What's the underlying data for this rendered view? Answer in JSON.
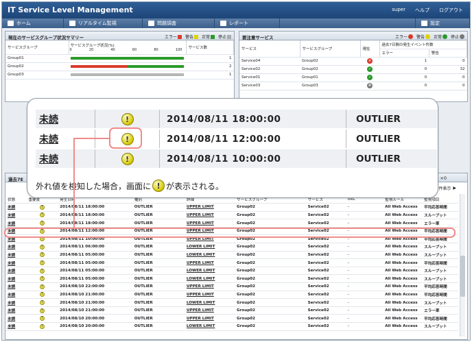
{
  "app": {
    "title": "IT Service Level Management",
    "user": "super",
    "help": "ヘルプ",
    "logout": "ログアウト"
  },
  "nav": {
    "home": "ホーム",
    "realtime": "リアルタイム監視",
    "problem": "問題調査",
    "report": "レポート",
    "settings": "設定"
  },
  "summary": {
    "title": "現在のサービスグループ状況サマリー",
    "legend": {
      "error": "エラー",
      "warning": "警告",
      "normal": "正常",
      "stopped": "停止"
    },
    "col_group": "サービスグループ",
    "col_status": "サービスグループ状況(%)",
    "col_count": "サービス数",
    "ticks": [
      "0",
      "20",
      "40",
      "60",
      "80",
      "100"
    ],
    "rows": [
      {
        "group": "Group01",
        "error_pct": 0,
        "normal_pct": 100,
        "count": "1"
      },
      {
        "group": "Group02",
        "error_pct": 50,
        "normal_pct": 50,
        "count": "2"
      },
      {
        "group": "Group03",
        "error_pct": 0,
        "normal_pct": 0,
        "count": "1"
      }
    ]
  },
  "attention": {
    "title": "要注意サービス",
    "legend": {
      "error": "エラー",
      "warning": "警告",
      "normal": "正常",
      "stopped": "停止"
    },
    "col_service": "サービス",
    "col_group": "サービスグループ",
    "col_now": "現在",
    "col_events": "過去7日間の発生イベント件数",
    "col_error": "エラー",
    "col_warning": "警告",
    "rows": [
      {
        "service": "Service04",
        "group": "Group02",
        "status": "error",
        "errors": "1",
        "warnings": "0"
      },
      {
        "service": "Service02",
        "group": "Group02",
        "status": "normal",
        "errors": "0",
        "warnings": "32"
      },
      {
        "service": "Service01",
        "group": "Group01",
        "status": "normal",
        "errors": "0",
        "warnings": "0"
      },
      {
        "service": "Service03",
        "group": "Group03",
        "status": "stopped",
        "errors": "0",
        "warnings": "0"
      }
    ]
  },
  "events": {
    "title_partial": "過去7E",
    "count_suffix": "件表示",
    "count_value": "0",
    "header_partial_right": "×0",
    "cols": {
      "state": "状態",
      "severity": "重要度",
      "time": "発生日時",
      "type": "種別",
      "detail": "詳細",
      "group": "サービスグループ",
      "service": "サービス",
      "url": "URL",
      "monitor": "監視ルール",
      "item": "監視項目"
    },
    "rows": [
      {
        "state": "未読",
        "time": "2014/08/11 18:00:00",
        "type": "OUTLIER",
        "detail": "UPPER LIMIT",
        "group": "Group02",
        "service": "Service02",
        "url": "–",
        "monitor": "All Web Access",
        "item": "平均応答時間"
      },
      {
        "state": "未読",
        "time": "2014/08/11 18:00:00",
        "type": "OUTLIER",
        "detail": "UPPER LIMIT",
        "group": "Group02",
        "service": "Service02",
        "url": "–",
        "monitor": "All Web Access",
        "item": "スループット"
      },
      {
        "state": "未読",
        "time": "2014/08/11 18:00:00",
        "type": "OUTLIER",
        "detail": "UPPER LIMIT",
        "group": "Group02",
        "service": "Service02",
        "url": "–",
        "monitor": "All Web Access",
        "item": "エラー率"
      },
      {
        "state": "未読",
        "time": "2014/08/11 12:00:00",
        "type": "OUTLIER",
        "detail": "UPPER LIMIT",
        "group": "Group02",
        "service": "Service02",
        "url": "–",
        "monitor": "All Web Access",
        "item": "平均応答時間"
      },
      {
        "state": "未読",
        "time": "2014/08/11 10:00:00",
        "type": "OUTLIER",
        "detail": "UPPER LIMIT",
        "group": "Group02",
        "service": "Service02",
        "url": "–",
        "monitor": "All Web Access",
        "item": "平均応答時間"
      },
      {
        "state": "未読",
        "time": "2014/08/11 06:00:00",
        "type": "OUTLIER",
        "detail": "LOWER LIMIT",
        "group": "Group02",
        "service": "Service02",
        "url": "–",
        "monitor": "All Web Access",
        "item": "スループット"
      },
      {
        "state": "未読",
        "time": "2014/08/11 05:00:00",
        "type": "OUTLIER",
        "detail": "LOWER LIMIT",
        "group": "Group02",
        "service": "Service02",
        "url": "–",
        "monitor": "All Web Access",
        "item": "スループット"
      },
      {
        "state": "未読",
        "time": "2014/08/11 05:00:00",
        "type": "OUTLIER",
        "detail": "UPPER LIMIT",
        "group": "Group02",
        "service": "Service02",
        "url": "–",
        "monitor": "All Web Access",
        "item": "平均応答時間"
      },
      {
        "state": "未読",
        "time": "2014/08/11 05:00:00",
        "type": "OUTLIER",
        "detail": "LOWER LIMIT",
        "group": "Group02",
        "service": "Service02",
        "url": "–",
        "monitor": "All Web Access",
        "item": "スループット"
      },
      {
        "state": "未読",
        "time": "2014/08/11 05:00:00",
        "type": "OUTLIER",
        "detail": "LOWER LIMIT",
        "group": "Group02",
        "service": "Service02",
        "url": "–",
        "monitor": "All Web Access",
        "item": "スループット"
      },
      {
        "state": "未読",
        "time": "2014/08/10 22:00:00",
        "type": "OUTLIER",
        "detail": "UPPER LIMIT",
        "group": "Group02",
        "service": "Service02",
        "url": "–",
        "monitor": "All Web Access",
        "item": "平均応答時間"
      },
      {
        "state": "未読",
        "time": "2014/08/10 21:00:00",
        "type": "OUTLIER",
        "detail": "UPPER LIMIT",
        "group": "Group02",
        "service": "Service02",
        "url": "–",
        "monitor": "All Web Access",
        "item": "平均応答時間"
      },
      {
        "state": "未読",
        "time": "2014/08/10 21:00:00",
        "type": "OUTLIER",
        "detail": "LOWER LIMIT",
        "group": "Group02",
        "service": "Service02",
        "url": "–",
        "monitor": "All Web Access",
        "item": "スループット"
      },
      {
        "state": "未読",
        "time": "2014/08/10 21:00:00",
        "type": "OUTLIER",
        "detail": "UPPER LIMIT",
        "group": "Group02",
        "service": "Service02",
        "url": "–",
        "monitor": "All Web Access",
        "item": "エラー率"
      },
      {
        "state": "未読",
        "time": "2014/08/10 20:00:00",
        "type": "OUTLIER",
        "detail": "UPPER LIMIT",
        "group": "Group02",
        "service": "Service02",
        "url": "–",
        "monitor": "All Web Access",
        "item": "平均応答時間"
      },
      {
        "state": "未読",
        "time": "2014/08/10 20:00:00",
        "type": "OUTLIER",
        "detail": "LOWER LIMIT",
        "group": "Group02",
        "service": "Service02",
        "url": "–",
        "monitor": "All Web Access",
        "item": "スループット"
      }
    ]
  },
  "callout": {
    "rows": [
      {
        "state": "未読",
        "time": "2014/08/11 18:00:00",
        "type": "OUTLIER"
      },
      {
        "state": "未読",
        "time": "2014/08/11 12:00:00",
        "type": "OUTLIER"
      },
      {
        "state": "未読",
        "time": "2014/08/11 10:00:00",
        "type": "OUTLIER"
      }
    ],
    "caption_before": "外れ値を検知した場合，画面に",
    "caption_after": "が表示される。",
    "warning_glyph": "!"
  },
  "colors": {
    "error": "#d93a2b",
    "warning": "#e0d200",
    "normal": "#2a9a2a",
    "stopped": "#8a8a8a",
    "highlight": "#f08a8a"
  }
}
